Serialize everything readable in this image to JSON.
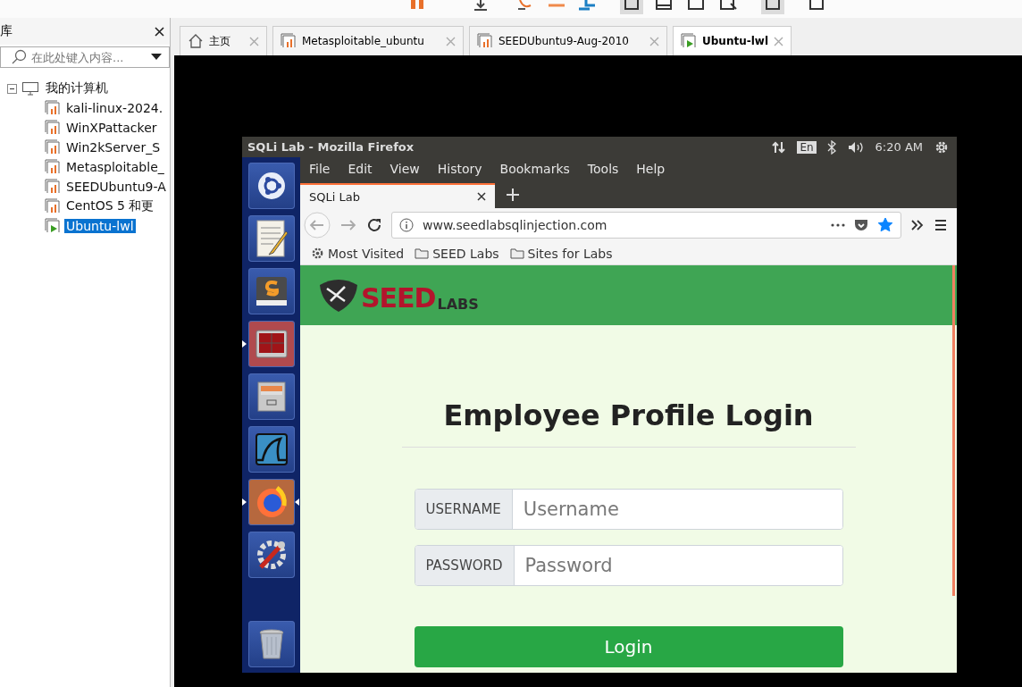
{
  "library": {
    "title": "库",
    "search": {
      "placeholder": "在此处键入内容..."
    },
    "tree": [
      {
        "label": "我的计算机",
        "expanded": true,
        "children": [
          {
            "label": "kali-linux-2024.",
            "running": false,
            "selected": false
          },
          {
            "label": "WinXPattacker",
            "running": false,
            "selected": false
          },
          {
            "label": "Win2kServer_S",
            "running": false,
            "selected": false
          },
          {
            "label": "Metasploitable_",
            "running": false,
            "selected": false
          },
          {
            "label": "SEEDUbuntu9-A",
            "running": false,
            "selected": false
          },
          {
            "label": "CentOS 5 和更",
            "running": false,
            "selected": false
          },
          {
            "label": "Ubuntu-lwl",
            "running": true,
            "selected": true
          }
        ]
      }
    ]
  },
  "tabs": [
    {
      "kind": "home",
      "label": "主页",
      "selected": false
    },
    {
      "kind": "vm",
      "label": "Metasploitable_ubuntu",
      "selected": false,
      "running": false
    },
    {
      "kind": "vm",
      "label": "SEEDUbuntu9-Aug-2010",
      "selected": false,
      "running": false
    },
    {
      "kind": "vm",
      "label": "Ubuntu-lwl",
      "selected": true,
      "running": true
    }
  ],
  "guest": {
    "window_title": "SQLi Lab - Mozilla Firefox",
    "keyboard": "En",
    "clock": "6:20 AM",
    "launcher": [
      {
        "kind": "ubuntu",
        "running": false,
        "focused": false
      },
      {
        "kind": "editor",
        "running": false,
        "focused": false
      },
      {
        "kind": "sublime",
        "running": false,
        "focused": false
      },
      {
        "kind": "terminal",
        "running": true,
        "focused": false
      },
      {
        "kind": "files",
        "running": false,
        "focused": false
      },
      {
        "kind": "wireshark",
        "running": false,
        "focused": false
      },
      {
        "kind": "firefox",
        "running": true,
        "focused": true
      },
      {
        "kind": "settings",
        "running": false,
        "focused": false
      },
      {
        "kind": "trash",
        "running": false,
        "focused": false
      }
    ],
    "browser": {
      "menu": [
        "File",
        "Edit",
        "View",
        "History",
        "Bookmarks",
        "Tools",
        "Help"
      ],
      "tab": "SQLi Lab",
      "url": "www.seedlabsqlinjection.com",
      "bookmarked": true,
      "bookmarks": [
        {
          "kind": "gear",
          "label": "Most Visited"
        },
        {
          "kind": "folder",
          "label": "SEED Labs"
        },
        {
          "kind": "folder",
          "label": "Sites for Labs"
        }
      ],
      "page": {
        "logo": [
          "SEED",
          "LABS"
        ],
        "heading": "Employee Profile Login",
        "fields": [
          {
            "label": "USERNAME",
            "placeholder": "Username"
          },
          {
            "label": "PASSWORD",
            "placeholder": "Password"
          }
        ],
        "button": "Login"
      }
    }
  }
}
